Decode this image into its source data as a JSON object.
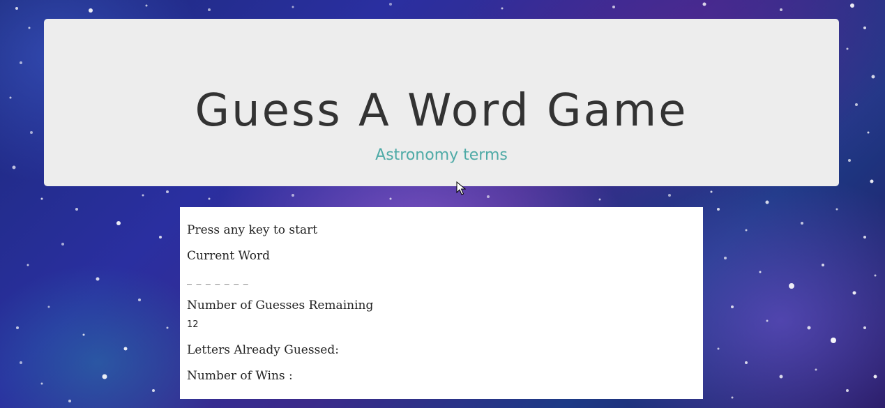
{
  "header": {
    "title": "Guess A Word Game",
    "subtitle": "Astronomy terms"
  },
  "game": {
    "prompt": "Press any key to start",
    "current_word_label": "Current Word",
    "current_word": "_ _ _ _ _ _ _",
    "guesses_remaining_label": "Number of Guesses Remaining",
    "guesses_remaining": "12",
    "letters_guessed_label": "Letters Already Guessed:",
    "letters_guessed": "",
    "wins_label": "Number of Wins :",
    "wins": ""
  },
  "colors": {
    "header_bg": "#ededed",
    "title": "#333333",
    "subtitle": "#4eaaa6",
    "panel_bg": "#ffffff"
  },
  "icons": {
    "cursor": "mouse-pointer-icon"
  }
}
